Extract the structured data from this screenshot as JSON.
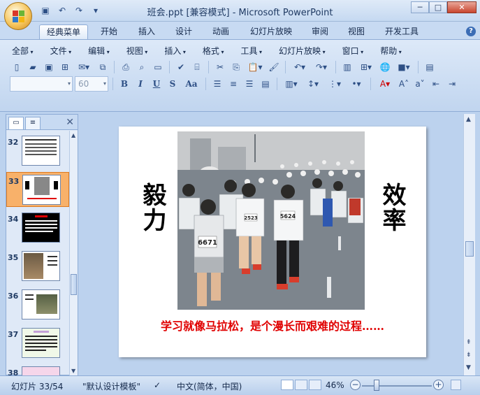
{
  "window": {
    "title": "班会.ppt [兼容模式] - Microsoft PowerPoint",
    "controls": {
      "minimize": "─",
      "maximize": "□",
      "close": "✕"
    }
  },
  "quick_access": [
    {
      "name": "save",
      "glyph": "💾"
    },
    {
      "name": "undo",
      "glyph": "↶"
    },
    {
      "name": "redo",
      "glyph": "↷"
    },
    {
      "name": "customize",
      "glyph": "▾"
    }
  ],
  "tabs": [
    "经典菜单",
    "开始",
    "插入",
    "设计",
    "动画",
    "幻灯片放映",
    "审阅",
    "视图",
    "开发工具"
  ],
  "active_tab": "经典菜单",
  "menus": [
    "全部",
    "文件",
    "编辑",
    "视图",
    "插入",
    "格式",
    "工具",
    "幻灯片放映",
    "窗口",
    "帮助"
  ],
  "font_box": {
    "family": "",
    "size": "60"
  },
  "format_buttons": [
    "B",
    "I",
    "U",
    "S",
    "Aa"
  ],
  "pane": {
    "tab_slides": "slides-icon",
    "tab_outline": "outline-icon",
    "close": "✕",
    "thumbnails": [
      {
        "num": "32",
        "kind": "text"
      },
      {
        "num": "33",
        "kind": "marathon",
        "selected": true
      },
      {
        "num": "34",
        "kind": "dark"
      },
      {
        "num": "35",
        "kind": "portrait"
      },
      {
        "num": "36",
        "kind": "portrait2"
      },
      {
        "num": "37",
        "kind": "text-color"
      },
      {
        "num": "38",
        "kind": "partial"
      }
    ]
  },
  "slide": {
    "left_text": "毅力",
    "right_text": "效率",
    "caption": "学习就像马拉松，是个漫长而艰难的过程……",
    "photo_bibs": [
      "6671",
      "5624",
      "2523"
    ]
  },
  "status": {
    "slide_indicator": "幻灯片 33/54",
    "template": "\"默认设计模板\"",
    "language": "中文(简体，中国)",
    "zoom": "46%"
  },
  "colors": {
    "caption": "#e00000",
    "accent": "#f8b16a"
  }
}
